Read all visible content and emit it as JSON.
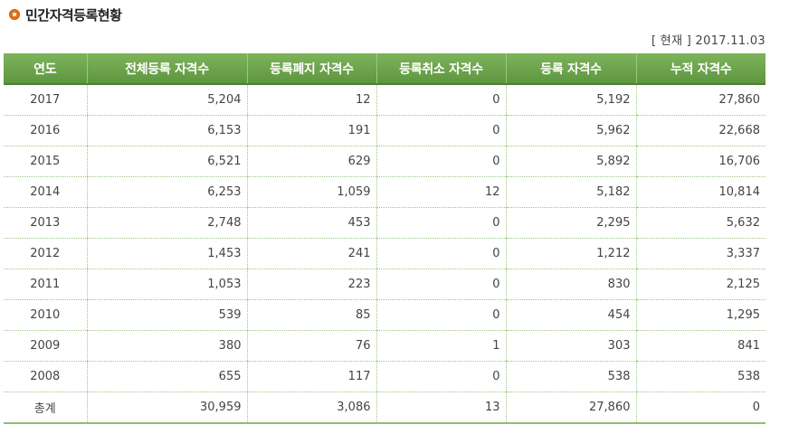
{
  "title": "민간자격등록현황",
  "as_of": "[ 현재 ] 2017.11.03",
  "table": {
    "headers": [
      "연도",
      "전체등록 자격수",
      "등록폐지 자격수",
      "등록취소 자격수",
      "등록 자격수",
      "누적 자격수"
    ],
    "rows": [
      {
        "year": "2017",
        "total": "5,204",
        "abolished": "12",
        "cancelled": "0",
        "registered": "5,192",
        "cumulative": "27,860"
      },
      {
        "year": "2016",
        "total": "6,153",
        "abolished": "191",
        "cancelled": "0",
        "registered": "5,962",
        "cumulative": "22,668"
      },
      {
        "year": "2015",
        "total": "6,521",
        "abolished": "629",
        "cancelled": "0",
        "registered": "5,892",
        "cumulative": "16,706"
      },
      {
        "year": "2014",
        "total": "6,253",
        "abolished": "1,059",
        "cancelled": "12",
        "registered": "5,182",
        "cumulative": "10,814"
      },
      {
        "year": "2013",
        "total": "2,748",
        "abolished": "453",
        "cancelled": "0",
        "registered": "2,295",
        "cumulative": "5,632"
      },
      {
        "year": "2012",
        "total": "1,453",
        "abolished": "241",
        "cancelled": "0",
        "registered": "1,212",
        "cumulative": "3,337"
      },
      {
        "year": "2011",
        "total": "1,053",
        "abolished": "223",
        "cancelled": "0",
        "registered": "830",
        "cumulative": "2,125"
      },
      {
        "year": "2010",
        "total": "539",
        "abolished": "85",
        "cancelled": "0",
        "registered": "454",
        "cumulative": "1,295"
      },
      {
        "year": "2009",
        "total": "380",
        "abolished": "76",
        "cancelled": "1",
        "registered": "303",
        "cumulative": "841"
      },
      {
        "year": "2008",
        "total": "655",
        "abolished": "117",
        "cancelled": "0",
        "registered": "538",
        "cumulative": "538"
      }
    ],
    "total_row": {
      "year": "총계",
      "total": "30,959",
      "abolished": "3,086",
      "cancelled": "13",
      "registered": "27,860",
      "cumulative": "0"
    }
  },
  "colors": {
    "header_bg": "#6aa048",
    "bullet": "#e8701a",
    "divider": "#9cc881"
  },
  "icons": {
    "title_bullet": "orange-circle-bullet-icon"
  }
}
